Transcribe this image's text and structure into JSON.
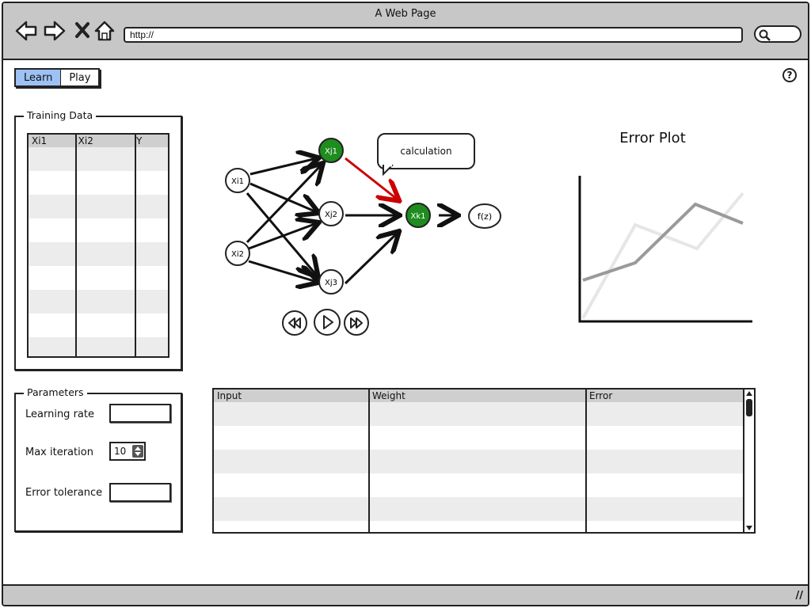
{
  "window": {
    "title": "A Web Page",
    "address": "http://"
  },
  "tabs": [
    {
      "label": "Learn",
      "active": true
    },
    {
      "label": "Play",
      "active": false
    }
  ],
  "help": {
    "label": "?"
  },
  "training": {
    "legend": "Training Data",
    "columns": [
      "Xi1",
      "Xi2",
      "Y"
    ]
  },
  "network": {
    "nodes": {
      "xi1": "Xi1",
      "xi2": "Xi2",
      "xj1": "Xj1",
      "xj2": "Xj2",
      "xj3": "Xj3",
      "xk1": "Xk1",
      "fz": "f(z)"
    },
    "highlight_color": "#1e8c1e",
    "active_edge_color": "#cc0000",
    "callout": "calculation"
  },
  "error_plot": {
    "title": "Error Plot"
  },
  "parameters": {
    "legend": "Parameters",
    "learning_rate_label": "Learning rate",
    "learning_rate_value": "",
    "max_iteration_label": "Max iteration",
    "max_iteration_value": "10",
    "error_tolerance_label": "Error tolerance",
    "error_tolerance_value": ""
  },
  "results": {
    "columns": [
      "Input",
      "Weight",
      "Error"
    ]
  }
}
